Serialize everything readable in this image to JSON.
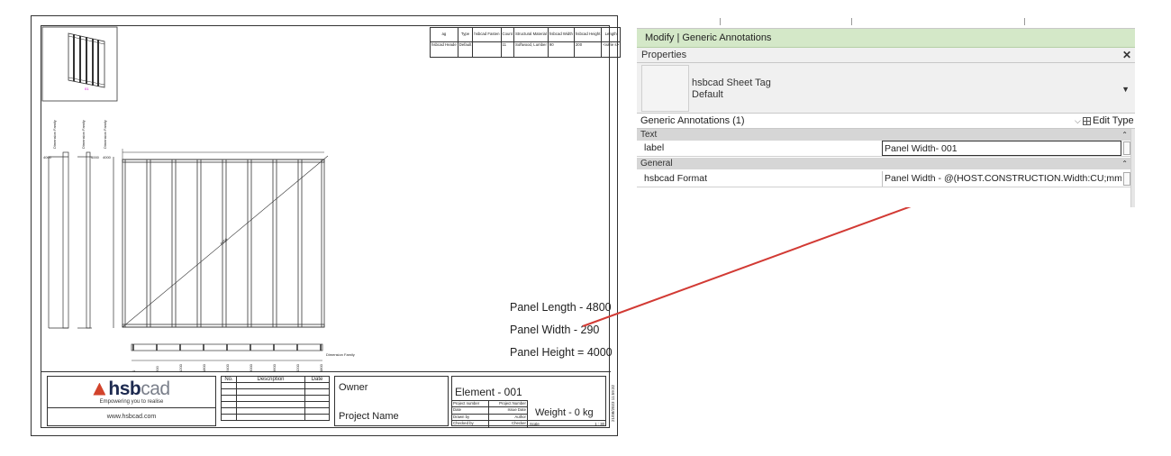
{
  "sheet": {
    "schedule": {
      "headers": [
        "ag",
        "Type",
        "hsbcad Fasten",
        "Count",
        "Structural Material",
        "hsbcad Width",
        "hsbcad Height",
        "Length"
      ],
      "row": [
        "hsbcad Heade",
        "Default",
        "",
        "11",
        "Softwood, Lumber",
        "90",
        "200",
        "<varie s>"
      ]
    },
    "drawing_labels": {
      "dim_family_1": "Dimension Family",
      "dim_family_2": "Dimension Family",
      "dim_family_3": "Dimension Family",
      "diagonal": "6250",
      "bottom_ticks": [
        "0",
        "600",
        "1200",
        "1800",
        "2400",
        "3000",
        "3600",
        "4200",
        "4800"
      ],
      "height_value": "4000",
      "panel_tag": "01"
    },
    "panel_info": {
      "length": "Panel Length - 4800",
      "width": "Panel Width - 290",
      "height": "Panel Height = 4000"
    },
    "titleblock": {
      "logo_hsb": "hsb",
      "logo_cad": "cad",
      "tagline": "Empowering you to realise",
      "url": "www.hsbcad.com",
      "rev_headers": [
        "No.",
        "Description",
        "Date"
      ],
      "owner": "Owner",
      "project_name": "Project Name",
      "element": "Element - 001",
      "rows": [
        [
          "Project number",
          "Project Number"
        ],
        [
          "Date",
          "Issue Date"
        ],
        [
          "Drawn by",
          "Author"
        ],
        [
          "Checked by",
          "Checker"
        ]
      ],
      "weight": "Weight - 0 kg",
      "scale_label": "Scale",
      "scale_value": "1 : 30",
      "sheet_id": "21/08/2023 11:59:32"
    }
  },
  "revit": {
    "modify_bar": "Modify | Generic Annotations",
    "properties_title": "Properties",
    "close_icon": "close-icon",
    "type_name": "hsbcad Sheet Tag",
    "type_sub": "Default",
    "instance_selector": "Generic Annotations (1)",
    "edit_type": "Edit Type",
    "groups": [
      {
        "name": "Text",
        "params": [
          {
            "name": "label",
            "value": "Panel Width- 001"
          }
        ]
      },
      {
        "name": "General",
        "params": [
          {
            "name": "hsbcad Format",
            "value": "Panel Width - @(HOST.CONSTRUCTION.Width:CU;mm)"
          }
        ]
      }
    ]
  },
  "colors": {
    "modify_bar": "#d4e8c8",
    "connector": "#d23a34",
    "logo_red": "#d2432b",
    "logo_navy": "#1d2a50",
    "magenta": "#d400d4"
  }
}
